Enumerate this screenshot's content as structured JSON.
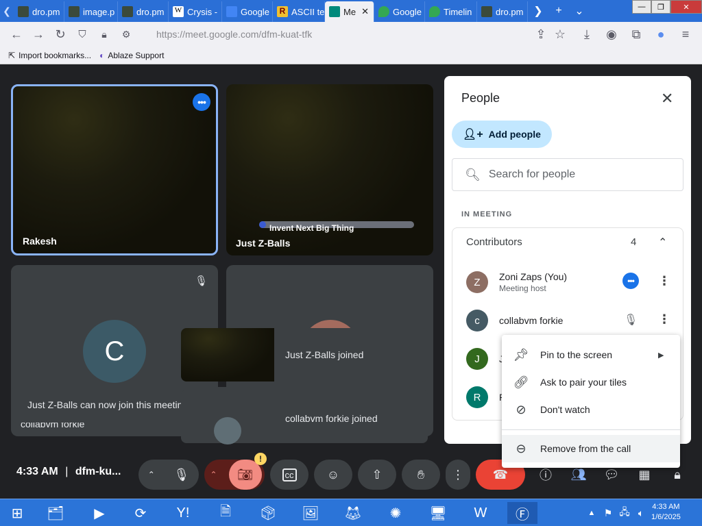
{
  "browser": {
    "tabs": [
      {
        "label": "dro.pm",
        "icon": "dro-favicon"
      },
      {
        "label": "image.p",
        "icon": "dro-favicon"
      },
      {
        "label": "dro.pm",
        "icon": "dro-favicon"
      },
      {
        "label": "Crysis -",
        "icon": "wikipedia-favicon"
      },
      {
        "label": "Google",
        "icon": "google-translate-favicon"
      },
      {
        "label": "ASCII te",
        "icon": "r-favicon"
      },
      {
        "label": "Me",
        "icon": "google-meet-favicon",
        "active": true
      },
      {
        "label": "Google",
        "icon": "google-maps-favicon"
      },
      {
        "label": "Timelin",
        "icon": "google-maps-favicon"
      },
      {
        "label": "dro.pm",
        "icon": "dro-favicon"
      }
    ],
    "url_host": "https://meet.google.com",
    "url_path": "/dfm-kuat-tfk",
    "bookmarks": [
      "Import bookmarks...",
      "Ablaze Support"
    ]
  },
  "tiles": [
    {
      "name": "Rakesh"
    },
    {
      "name": "Just Z-Balls",
      "caption": "Invent Next Big Thing"
    },
    {
      "name": "collabvm forkie",
      "initial": "C"
    }
  ],
  "notifications": {
    "can_join": "Just Z-Balls can now join this meeting",
    "joined_1": "Just Z-Balls joined",
    "joined_2": "collabvm forkie joined"
  },
  "people_panel": {
    "title": "People",
    "add_people": "Add people",
    "search_placeholder": "Search for people",
    "section_label": "IN MEETING",
    "group_label": "Contributors",
    "group_count": "4",
    "people": [
      {
        "initial": "Z",
        "name": "Zoni Zaps (You)",
        "sub": "Meeting host",
        "color": "#8d6e63"
      },
      {
        "initial": "c",
        "name": "collabvm forkie",
        "color": "#455a64"
      },
      {
        "initial": "J",
        "name": "J",
        "color": "#33691e"
      },
      {
        "initial": "R",
        "name": "R",
        "color": "#00796b"
      }
    ]
  },
  "context_menu": {
    "items": [
      "Pin to the screen",
      "Ask to pair your tiles",
      "Don't watch",
      "Remove from the call"
    ]
  },
  "bottom_bar": {
    "time": "4:33 AM",
    "separator": "|",
    "meeting_code": "dfm-ku...",
    "camera_warning": "!",
    "end_call_color": "#ea4335"
  },
  "taskbar": {
    "time": "4:33 AM",
    "date": "1/6/2025"
  }
}
